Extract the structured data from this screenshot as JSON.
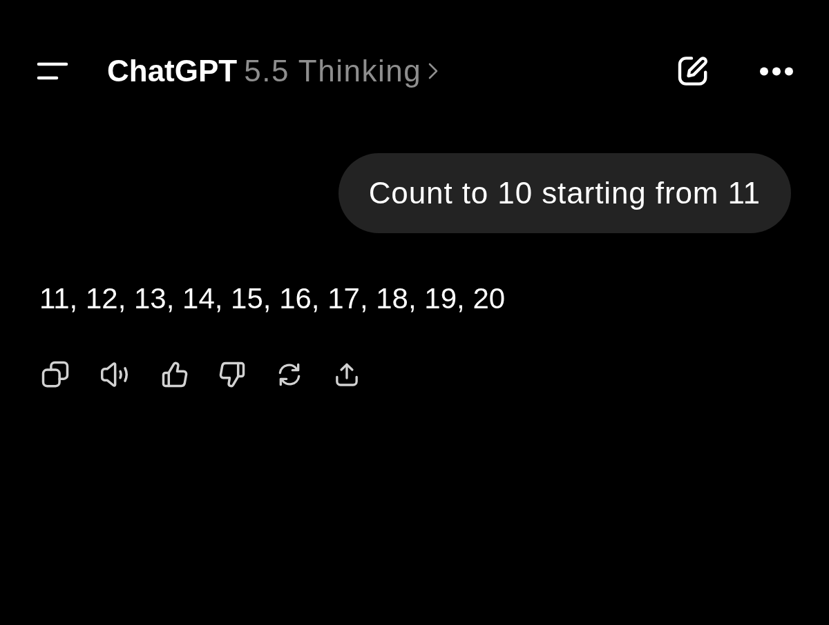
{
  "header": {
    "app_name": "ChatGPT",
    "model": "5.5 Thinking"
  },
  "conversation": [
    {
      "kind": "user",
      "text": "Count to 10 starting from 11"
    },
    {
      "kind": "assistant",
      "text": "11, 12, 13, 14, 15, 16, 17, 18, 19, 20"
    }
  ]
}
